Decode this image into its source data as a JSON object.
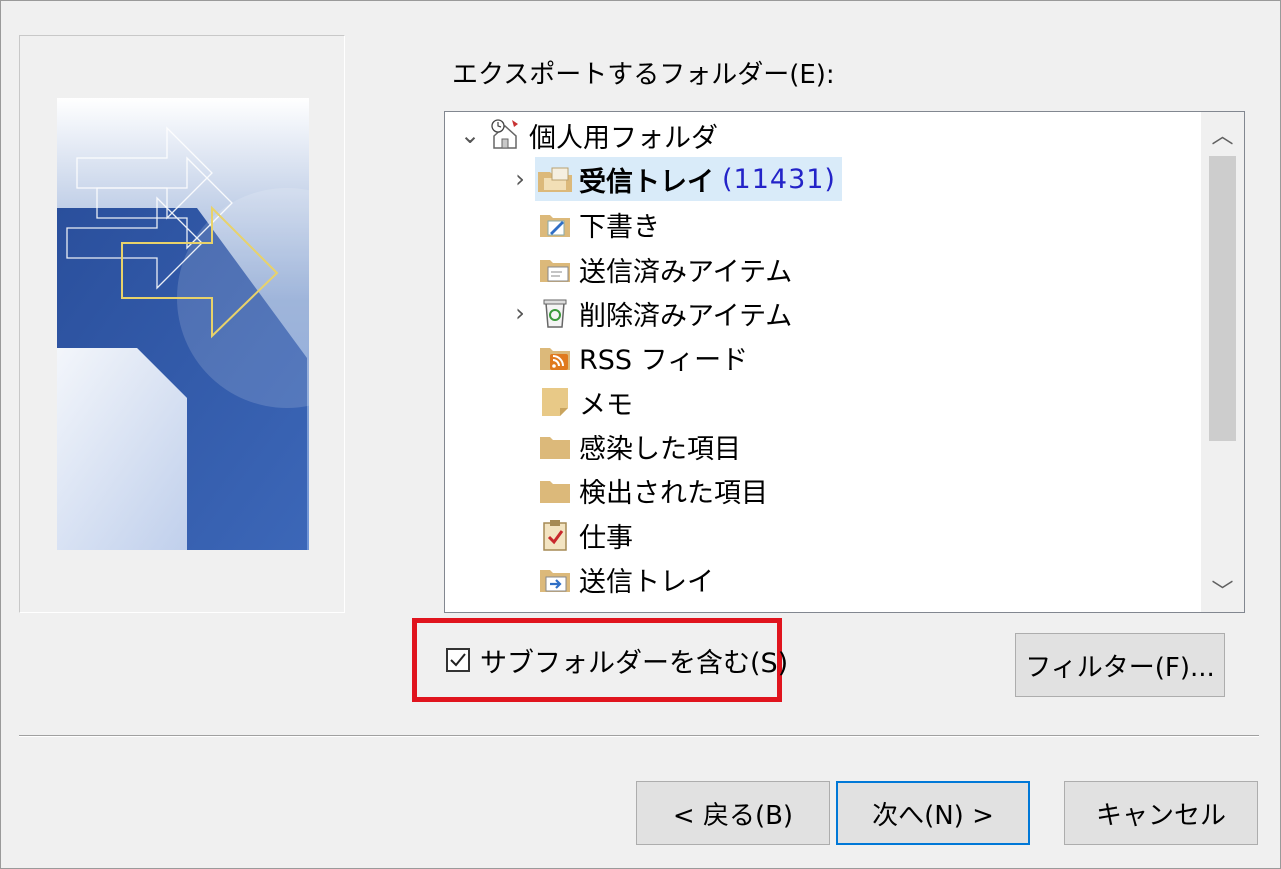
{
  "dialog": {
    "folder_label": "エクスポートするフォルダー(E):",
    "include_subfolders_label": "サブフォルダーを含む(S)",
    "include_subfolders_checked": true,
    "filter_button": "フィルター(F)...",
    "back_button": "< 戻る(B)",
    "next_button": "次へ(N) >",
    "cancel_button": "キャンセル"
  },
  "tree": {
    "root": {
      "label": "個人用フォルダ",
      "icon": "personal-folders-icon",
      "expanded": true
    },
    "items": [
      {
        "label": "受信トレイ",
        "count": "(11431)",
        "icon": "inbox-folder-icon",
        "expandable": true,
        "selected": true,
        "bold": true
      },
      {
        "label": "下書き",
        "icon": "drafts-folder-icon"
      },
      {
        "label": "送信済みアイテム",
        "icon": "sent-items-folder-icon"
      },
      {
        "label": "削除済みアイテム",
        "icon": "deleted-items-icon",
        "expandable": true
      },
      {
        "label": "RSS フィード",
        "icon": "rss-folder-icon"
      },
      {
        "label": "メモ",
        "icon": "notes-folder-icon"
      },
      {
        "label": "感染した項目",
        "icon": "folder-icon"
      },
      {
        "label": "検出された項目",
        "icon": "folder-icon"
      },
      {
        "label": "仕事",
        "icon": "tasks-folder-icon"
      },
      {
        "label": "送信トレイ",
        "icon": "outbox-folder-icon"
      }
    ]
  },
  "colors": {
    "selection": "#d9ebf9",
    "count": "#2323c8",
    "highlight_box": "#e0141e",
    "default_button_border": "#0078d7"
  }
}
